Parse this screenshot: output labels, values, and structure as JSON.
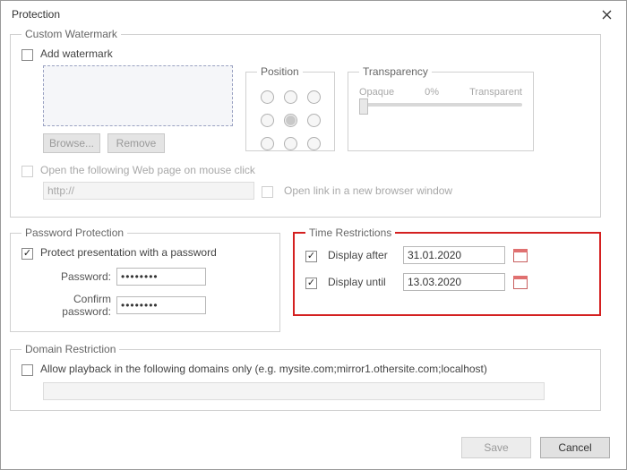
{
  "window": {
    "title": "Protection"
  },
  "watermark": {
    "legend": "Custom Watermark",
    "add_label": "Add watermark",
    "browse_label": "Browse...",
    "remove_label": "Remove",
    "open_link_label": "Open the following Web page on mouse click",
    "url_placeholder": "http://",
    "open_new_label": "Open link in a new browser window",
    "position_legend": "Position",
    "transparency_legend": "Transparency",
    "opaque_label": "Opaque",
    "percent_label": "0%",
    "transparent_label": "Transparent"
  },
  "password": {
    "legend": "Password Protection",
    "protect_label": "Protect presentation with a password",
    "pw_label": "Password:",
    "confirm_label": "Confirm password:",
    "pw_value": "••••••••",
    "confirm_value": "••••••••"
  },
  "time": {
    "legend": "Time Restrictions",
    "after_label": "Display after",
    "until_label": "Display until",
    "after_value": "31.01.2020",
    "until_value": "13.03.2020"
  },
  "domain": {
    "legend": "Domain Restriction",
    "allow_label": "Allow playback in the following domains only (e.g. mysite.com;mirror1.othersite.com;localhost)"
  },
  "footer": {
    "save_label": "Save",
    "cancel_label": "Cancel"
  }
}
